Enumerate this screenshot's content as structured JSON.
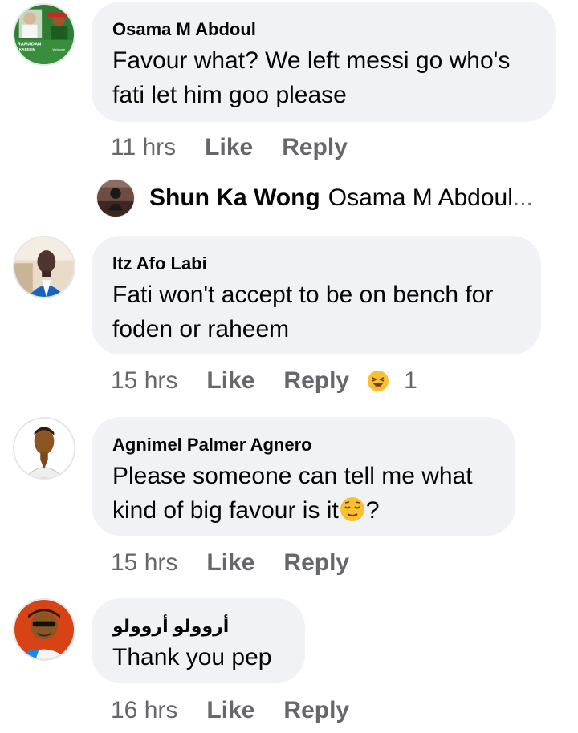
{
  "comments": [
    {
      "author": "Osama M Abdoul",
      "text": "Favour what? We left messi go who's fati let him goo please",
      "time": "11 hrs",
      "like": "Like",
      "reply": "Reply",
      "avatar_text": [
        "RAMADAN",
        "KAREEM",
        "Welcome"
      ]
    },
    {
      "author": "Itz Afo Labi",
      "text": "Fati won't accept to be on bench for foden or raheem",
      "time": "15 hrs",
      "like": "Like",
      "reply": "Reply",
      "reaction": {
        "icon": "haha-emoji",
        "count": "1"
      }
    },
    {
      "author": "Agnimel Palmer Agnero",
      "text": "Please someone can tell me what kind of big favour is it",
      "text_suffix": "?",
      "time": "15 hrs",
      "like": "Like",
      "reply": "Reply",
      "inline_emoji": "relieved-face-emoji"
    },
    {
      "author": "أروولو أروولو",
      "text": "Thank you pep",
      "time": "16 hrs",
      "like": "Like",
      "reply": "Reply"
    }
  ],
  "reply_preview": {
    "author": "Shun Ka Wong",
    "snippet": "Osama M Abdoul",
    "ellipsis": "..."
  },
  "colors": {
    "bubble": "#f0f2f5",
    "meta": "#65676b",
    "text": "#050505"
  }
}
